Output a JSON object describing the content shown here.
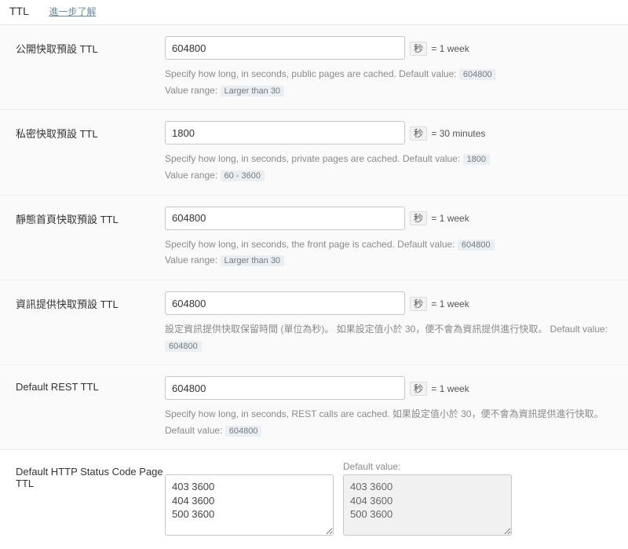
{
  "header": {
    "title": "TTL",
    "learn_more": "進一步了解"
  },
  "sections": {
    "public": {
      "label": "公開快取預設 TTL",
      "value": "604800",
      "unit_sec": "秒",
      "unit_eq": " = 1 week",
      "help1_pre": "Specify how long, in seconds, public pages are cached. Default value: ",
      "help1_code": "604800",
      "help2_pre": "Value range: ",
      "help2_code": "Larger than 30"
    },
    "private": {
      "label": "私密快取預設 TTL",
      "value": "1800",
      "unit_sec": "秒",
      "unit_eq": " = 30 minutes",
      "help1_pre": "Specify how long, in seconds, private pages are cached. Default value: ",
      "help1_code": "1800",
      "help2_pre": "Value range: ",
      "help2_code": "60 - 3600"
    },
    "front": {
      "label": "靜態首頁快取預設 TTL",
      "value": "604800",
      "unit_sec": "秒",
      "unit_eq": " = 1 week",
      "help1_pre": "Specify how long, in seconds, the front page is cached. Default value: ",
      "help1_code": "604800",
      "help2_pre": "Value range: ",
      "help2_code": "Larger than 30"
    },
    "feed": {
      "label": "資訊提供快取預設 TTL",
      "value": "604800",
      "unit_sec": "秒",
      "unit_eq": " = 1 week",
      "help1_pre": "設定資訊提供快取保留時間 (單位為秒)。 如果設定值小於 30，便不會為資訊提供進行快取。 Default value: ",
      "help1_code": "604800"
    },
    "rest": {
      "label": "Default REST TTL",
      "value": "604800",
      "unit_sec": "秒",
      "unit_eq": " = 1 week",
      "help1_pre": "Specify how long, in seconds, REST calls are cached. 如果設定值小於 30，便不會為資訊提供進行快取。 Default value: ",
      "help1_code": "604800"
    },
    "status": {
      "label": "Default HTTP Status Code Page TTL",
      "value": "403 3600\n404 3600\n500 3600",
      "default_label": "Default value:",
      "default_value": "403 3600\n404 3600\n500 3600"
    }
  }
}
